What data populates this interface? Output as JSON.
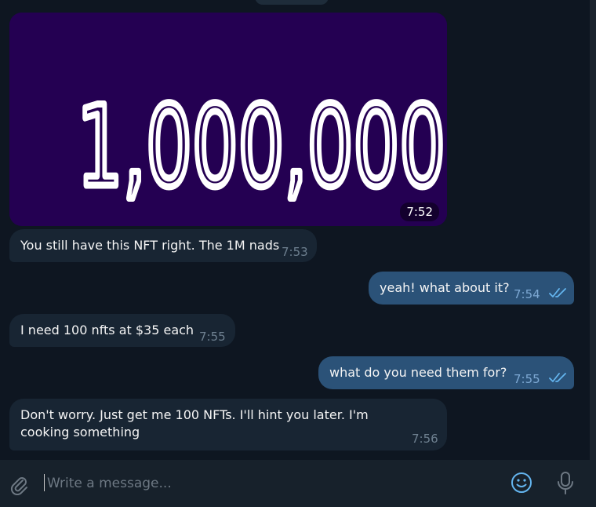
{
  "messages": [
    {
      "direction": "in",
      "type": "image",
      "image_text": "1,000,000",
      "time": "7:52"
    },
    {
      "direction": "in",
      "text": "You still have this NFT right. The 1M nads",
      "time": "7:53"
    },
    {
      "direction": "out",
      "text": "yeah! what about it?",
      "time": "7:54",
      "status": "read"
    },
    {
      "direction": "in",
      "text": "I need 100 nfts at $35 each",
      "time": "7:55"
    },
    {
      "direction": "out",
      "text": "what do you need them for?",
      "time": "7:55",
      "status": "read"
    },
    {
      "direction": "in",
      "text": "Don't worry. Just get me 100 NFTs. I'll hint you later. I'm cooking something",
      "time": "7:56"
    }
  ],
  "composer": {
    "placeholder": "Write a message...",
    "attach_icon": "paperclip-icon",
    "emoji_icon": "smiley-icon",
    "mic_icon": "microphone-icon"
  },
  "colors": {
    "background": "#0e1621",
    "incoming_bubble": "#182533",
    "outgoing_bubble": "#2b5278",
    "image_background": "#240052",
    "accent": "#64b5ef"
  }
}
